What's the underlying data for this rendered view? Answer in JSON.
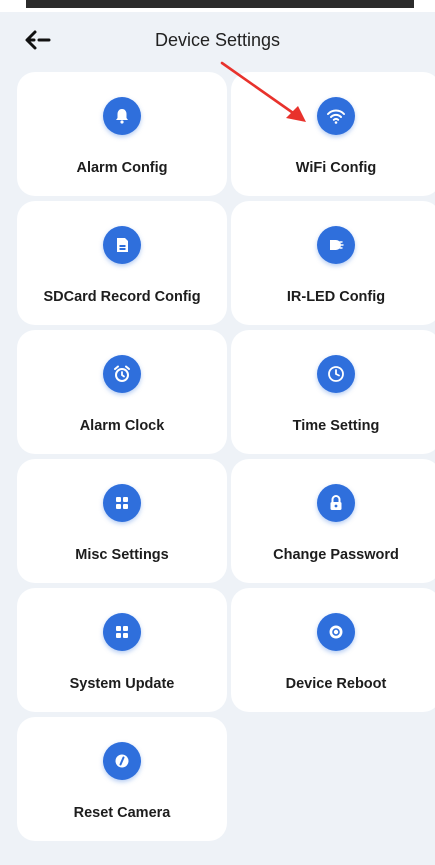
{
  "header": {
    "title": "Device Settings",
    "back_icon": "back-arrow-icon"
  },
  "colors": {
    "background": "#eef2f7",
    "card": "#ffffff",
    "icon_circle": "#2f6fdc",
    "annotation_arrow": "#e8322c"
  },
  "settings": [
    {
      "label": "Alarm Config",
      "icon": "bell-icon"
    },
    {
      "label": "WiFi Config",
      "icon": "wifi-icon"
    },
    {
      "label": "SDCard Record Config",
      "icon": "sdcard-icon"
    },
    {
      "label": "IR-LED Config",
      "icon": "ir-led-icon"
    },
    {
      "label": "Alarm Clock",
      "icon": "alarm-clock-icon"
    },
    {
      "label": "Time Setting",
      "icon": "clock-icon"
    },
    {
      "label": "Misc Settings",
      "icon": "grid-icon"
    },
    {
      "label": "Change Password",
      "icon": "lock-icon"
    },
    {
      "label": "System Update",
      "icon": "grid-icon"
    },
    {
      "label": "Device Reboot",
      "icon": "reboot-icon"
    },
    {
      "label": "Reset Camera",
      "icon": "reset-icon"
    }
  ]
}
